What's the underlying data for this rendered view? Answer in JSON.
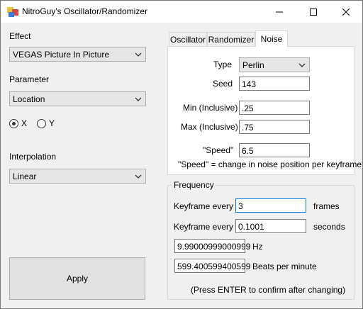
{
  "window": {
    "title": "NitroGuy's Oscillator/Randomizer",
    "controls": {
      "minimize_icon": "minimize-icon",
      "maximize_icon": "maximize-icon",
      "close_icon": "close-icon"
    }
  },
  "effect": {
    "label": "Effect",
    "selected": "VEGAS Picture In Picture"
  },
  "parameter": {
    "label": "Parameter",
    "selected": "Location"
  },
  "axis": {
    "options": [
      "X",
      "Y"
    ],
    "selected": "X"
  },
  "interpolation": {
    "label": "Interpolation",
    "selected": "Linear"
  },
  "apply_button": "Apply",
  "tabs": [
    {
      "label": "Oscillator",
      "active": false
    },
    {
      "label": "Randomizer",
      "active": false
    },
    {
      "label": "Noise",
      "active": true
    }
  ],
  "noise": {
    "type_label": "Type",
    "type_value": "Perlin",
    "seed_label": "Seed",
    "seed_value": "143",
    "min_label": "Min (Inclusive)",
    "min_value": ".25",
    "max_label": "Max (Inclusive)",
    "max_value": ".75",
    "speed_label": "\"Speed\"",
    "speed_value": "6.5",
    "speed_help": "\"Speed\" = change in noise position per keyframe"
  },
  "frequency": {
    "title": "Frequency",
    "kf_frames_label": "Keyframe every",
    "kf_frames_value": "3",
    "kf_frames_unit": "frames",
    "kf_seconds_label": "Keyframe every",
    "kf_seconds_value": "0.1001",
    "kf_seconds_unit": "seconds",
    "hz_value": "9.99000999000999",
    "hz_unit": "Hz",
    "bpm_value": "599.400599400599",
    "bpm_unit": "Beats per minute",
    "hint": "(Press ENTER to confirm after changing)"
  },
  "colors": {
    "focus_border": "#0078d7",
    "window_bg": "#f0f0f0"
  }
}
